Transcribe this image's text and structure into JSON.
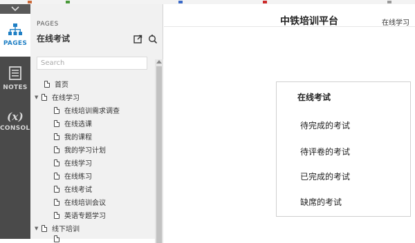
{
  "rail": {
    "tabs": [
      {
        "label": "PAGES",
        "icon": "sitemap-icon",
        "active": true
      },
      {
        "label": "NOTES",
        "icon": "notes-icon",
        "active": false
      },
      {
        "label": "CONSOLE",
        "icon": "variable-x-icon",
        "active": false
      }
    ]
  },
  "panel": {
    "caption": "PAGES",
    "title": "在线考试",
    "search_placeholder": "Search",
    "tree": [
      {
        "label": "首页",
        "level": 0,
        "expandable": false
      },
      {
        "label": "在线学习",
        "level": 0,
        "expandable": true
      },
      {
        "label": "在线培训需求调查",
        "level": 1,
        "expandable": false
      },
      {
        "label": "在线选课",
        "level": 1,
        "expandable": false
      },
      {
        "label": "我的课程",
        "level": 1,
        "expandable": false
      },
      {
        "label": "我的学习计划",
        "level": 1,
        "expandable": false
      },
      {
        "label": "在线学习",
        "level": 1,
        "expandable": false
      },
      {
        "label": "在线练习",
        "level": 1,
        "expandable": false
      },
      {
        "label": "在线考试",
        "level": 1,
        "expandable": false
      },
      {
        "label": "在线培训会议",
        "level": 1,
        "expandable": false
      },
      {
        "label": "英语专题学习",
        "level": 1,
        "expandable": false
      },
      {
        "label": "线下培训",
        "level": 0,
        "expandable": true
      }
    ]
  },
  "main": {
    "site_title": "中铁培训平台",
    "site_sub": "在线学习",
    "card": {
      "title": "在线考试",
      "items": [
        "待完成的考试",
        "待评卷的考试",
        "已完成的考试",
        "缺席的考试"
      ]
    }
  },
  "colors": {
    "rail_bg": "#4a4a4a",
    "active_tab_text": "#1f7fc4",
    "panel_bg": "#f1f1f1"
  }
}
